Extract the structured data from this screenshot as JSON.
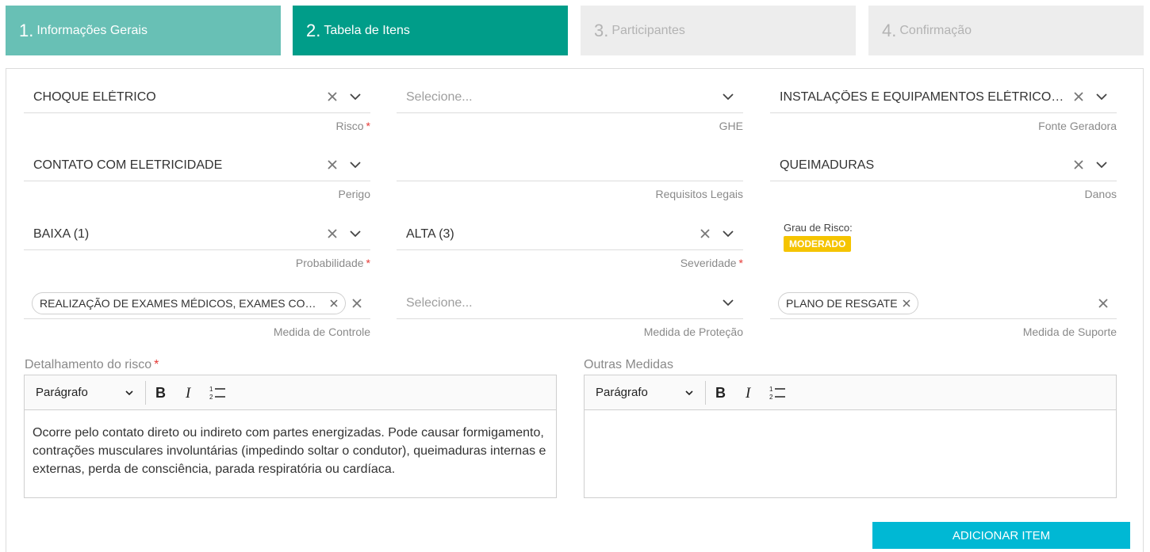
{
  "steps": [
    {
      "num": "1.",
      "label": "Informações Gerais"
    },
    {
      "num": "2.",
      "label": "Tabela de Itens"
    },
    {
      "num": "3.",
      "label": "Participantes"
    },
    {
      "num": "4.",
      "label": "Confirmação"
    }
  ],
  "fields": {
    "risco": {
      "value": "CHOQUE ELÉTRICO",
      "label": "Risco"
    },
    "ghe": {
      "placeholder": "Selecione...",
      "label": "GHE"
    },
    "fonte": {
      "value": "INSTALAÇÕES E EQUIPAMENTOS ELÉTRICOS E ELETRÔNICOS",
      "label": "Fonte Geradora"
    },
    "perigo": {
      "value": "CONTATO COM ELETRICIDADE",
      "label": "Perigo"
    },
    "requisitos": {
      "label": "Requisitos Legais"
    },
    "danos": {
      "value": "QUEIMADURAS",
      "label": "Danos"
    },
    "probabilidade": {
      "value": "BAIXA (1)",
      "label": "Probabilidade"
    },
    "severidade": {
      "value": "ALTA (3)",
      "label": "Severidade"
    },
    "controle": {
      "tag": "REALIZAÇÃO DE EXAMES MÉDICOS, EXAMES COMPLEMENTARES",
      "label": "Medida de Controle"
    },
    "protecao": {
      "placeholder": "Selecione...",
      "label": "Medida de Proteção"
    },
    "suporte": {
      "tag": "PLANO DE RESGATE",
      "label": "Medida de Suporte"
    }
  },
  "grau": {
    "label": "Grau de Risco:",
    "value": "MODERADO",
    "color": "#f5c400"
  },
  "editors": {
    "detalhamento": {
      "label": "Detalhamento do risco",
      "format": "Parágrafo",
      "text": "Ocorre pelo contato direto ou indireto com partes energizadas. Pode causar formigamento, contrações musculares involuntárias (impedindo soltar o condutor), queimaduras internas e externas, perda de consciência, parada respiratória ou cardíaca."
    },
    "outras": {
      "label": "Outras Medidas",
      "format": "Parágrafo",
      "text": ""
    }
  },
  "add_button": "ADICIONAR ITEM",
  "colors": {
    "step_done": "#68c0b5",
    "step_active": "#009d89",
    "step_pending": "#ededed",
    "button": "#00b8d4",
    "required": "#e53935"
  },
  "icons": [
    "clear-icon",
    "chevron-down-icon",
    "bold-icon",
    "italic-icon",
    "numbered-list-icon"
  ]
}
